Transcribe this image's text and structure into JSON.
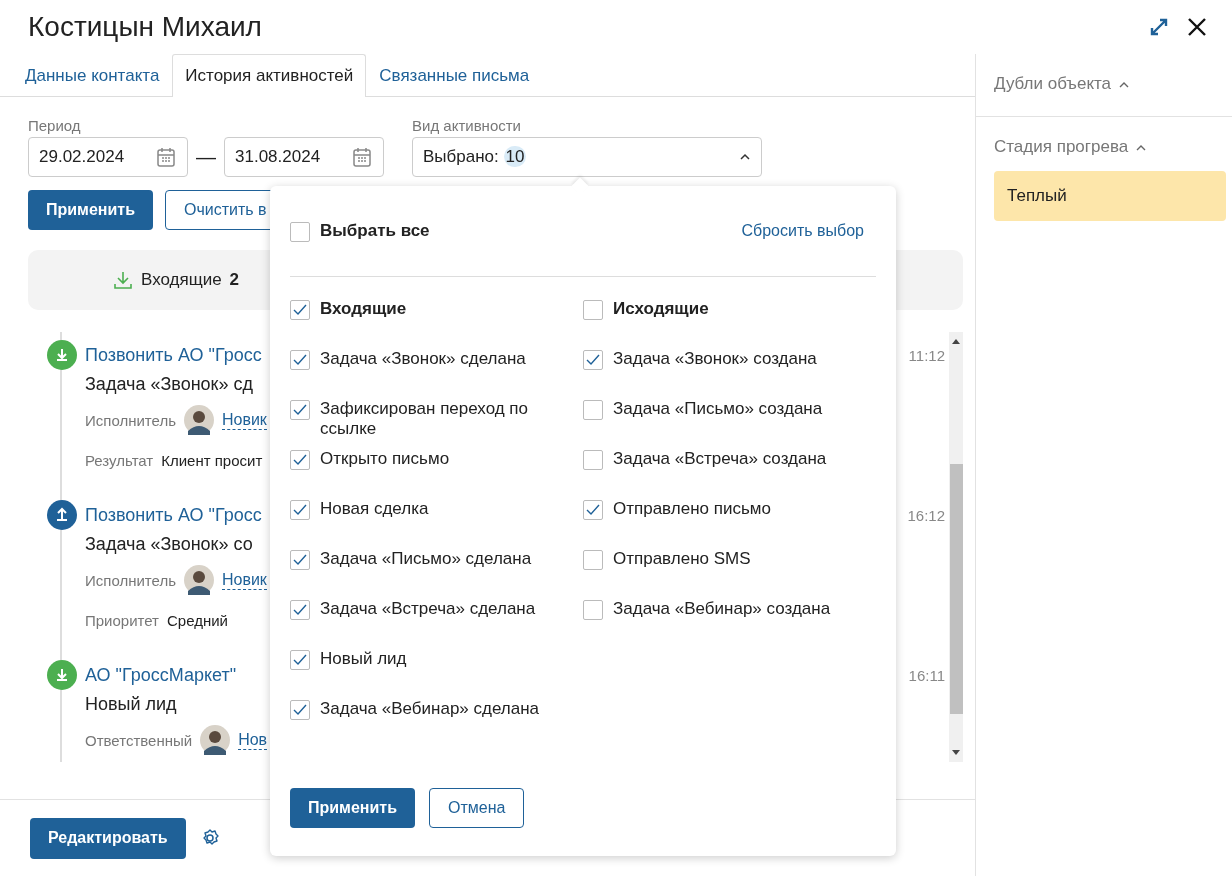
{
  "title": "Костицын Михаил",
  "tabs": [
    {
      "label": "Данные контакта",
      "selected": false
    },
    {
      "label": "История активностей",
      "selected": true
    },
    {
      "label": "Связанные письма",
      "selected": false
    }
  ],
  "filters": {
    "period_label": "Период",
    "date_from": "29.02.2024",
    "date_to": "31.08.2024",
    "dash": "—",
    "activity_label": "Вид активности",
    "activity_value": "Выбрано:",
    "activity_count": "10",
    "expanded": true
  },
  "filter_buttons": {
    "apply": "Применить",
    "clear": "Очистить в"
  },
  "summary": {
    "label": "Входящие",
    "count": "2"
  },
  "feed": [
    {
      "kind": "incoming",
      "title": "Позвонить АО \"Гросс",
      "subtitle": "Задача «Звонок» сд",
      "time": "11:12",
      "fields": [
        {
          "kind": "person",
          "label": "Исполнитель",
          "value": "Новик"
        },
        {
          "kind": "text",
          "label": "Результат",
          "value": "Клиент просит"
        }
      ]
    },
    {
      "kind": "outgoing",
      "title": "Позвонить АО \"Гросс",
      "subtitle": "Задача «Звонок» со",
      "time": "16:12",
      "fields": [
        {
          "kind": "person",
          "label": "Исполнитель",
          "value": "Новик"
        },
        {
          "kind": "text",
          "label": "Приоритет",
          "value": "Средний"
        }
      ]
    },
    {
      "kind": "incoming",
      "title": "АО \"ГроссМаркет\"",
      "subtitle": "Новый лид",
      "time": "16:11",
      "fields": [
        {
          "kind": "person",
          "label": "Ответственный",
          "value": "Нов"
        }
      ]
    }
  ],
  "footer": {
    "edit": "Редактировать"
  },
  "sidebar": [
    {
      "title": "Дубли объекта",
      "expanded": true
    },
    {
      "title": "Стадия прогрева",
      "expanded": true,
      "stage": "Теплый"
    }
  ],
  "dropdown": {
    "select_all": {
      "label": "Выбрать все",
      "checked": false
    },
    "reset": "Сбросить выбор",
    "columns": [
      [
        {
          "kind": "group",
          "label": "Входящие",
          "checked": true
        },
        {
          "kind": "option",
          "label": "Задача «Звонок» сделана",
          "checked": true
        },
        {
          "kind": "option",
          "label": "Зафиксирован переход по ссылке",
          "checked": true
        },
        {
          "kind": "option",
          "label": "Открыто письмо",
          "checked": true
        },
        {
          "kind": "option",
          "label": "Новая сделка",
          "checked": true
        },
        {
          "kind": "option",
          "label": "Задача «Письмо» сделана",
          "checked": true
        },
        {
          "kind": "option",
          "label": "Задача «Встреча» сделана",
          "checked": true
        },
        {
          "kind": "option",
          "label": "Новый лид",
          "checked": true
        },
        {
          "kind": "option",
          "label": "Задача «Вебинар» сделана",
          "checked": true
        }
      ],
      [
        {
          "kind": "group",
          "label": "Исходящие",
          "checked": false
        },
        {
          "kind": "option",
          "label": "Задача «Звонок» создана",
          "checked": true
        },
        {
          "kind": "option",
          "label": "Задача «Письмо» создана",
          "checked": false
        },
        {
          "kind": "option",
          "label": "Задача «Встреча» создана",
          "checked": false
        },
        {
          "kind": "option",
          "label": "Отправлено письмо",
          "checked": true
        },
        {
          "kind": "option",
          "label": "Отправлено SMS",
          "checked": false
        },
        {
          "kind": "option",
          "label": "Задача «Вебинар» создана",
          "checked": false
        }
      ]
    ],
    "apply": "Применить",
    "cancel": "Отмена"
  }
}
